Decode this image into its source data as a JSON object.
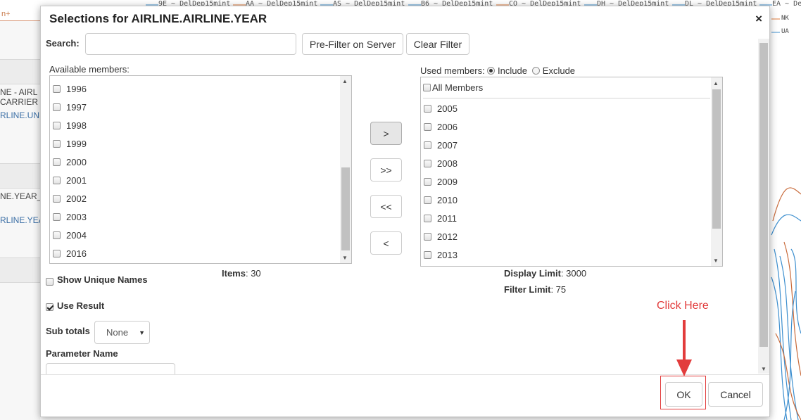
{
  "background": {
    "left_header": "n+",
    "left_texts": [
      "NE - AIRL",
      "CARRIER",
      "RLINE.UNI",
      "NE.YEAR_",
      "RLINE.YEA"
    ],
    "top_legend": [
      "9E ~ DelDep15mint",
      "AA ~ DelDep15mint",
      "AS ~ DelDep15mint",
      "B6 ~ DelDep15mint",
      "CO ~ DelDep15mint",
      "DH ~ DelDep15mint",
      "DL ~ DelDep15mint",
      "EA ~ De"
    ],
    "right_legend": [
      "NK",
      "UA"
    ]
  },
  "dialog": {
    "title": "Selections for AIRLINE.AIRLINE.YEAR",
    "close_glyph": "×",
    "search_label": "Search:",
    "search_value": "",
    "prefilter_button": "Pre-Filter on Server",
    "clear_filter_button": "Clear Filter",
    "available_label": "Available members:",
    "available_items": [
      "1996",
      "1997",
      "1998",
      "1999",
      "2000",
      "2001",
      "2002",
      "2003",
      "2004",
      "2016"
    ],
    "used_label": "Used members:",
    "include_label": "Include",
    "exclude_label": "Exclude",
    "mode_selected": "Include",
    "all_members_label": "All Members",
    "used_items": [
      "2005",
      "2006",
      "2007",
      "2008",
      "2009",
      "2010",
      "2011",
      "2012",
      "2013"
    ],
    "move_buttons": [
      ">",
      ">>",
      "<<",
      "<"
    ],
    "items_label": "Items",
    "items_value": ": 30",
    "display_limit_label": "Display Limit",
    "display_limit_value": ": 3000",
    "filter_limit_label": "Filter Limit",
    "filter_limit_value": ": 75",
    "show_unique_names_label": "Show Unique Names",
    "show_unique_names_checked": false,
    "use_result_label": "Use Result",
    "use_result_checked": true,
    "sub_totals_label": "Sub totals",
    "sub_totals_value": "None",
    "parameter_name_label": "Parameter Name",
    "parameter_name_value": "",
    "ok_button": "OK",
    "cancel_button": "Cancel"
  },
  "annotation": {
    "text": "Click Here",
    "color": "#e23c3c"
  }
}
